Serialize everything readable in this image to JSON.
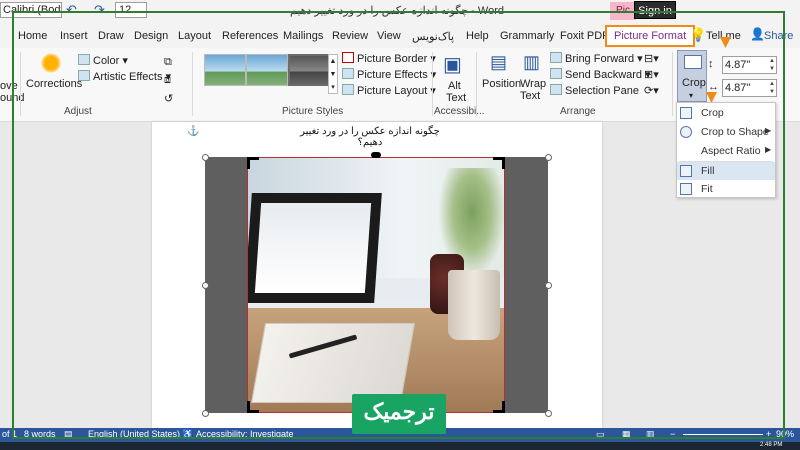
{
  "titlebar": {
    "font_name": "Calibri (Body",
    "font_size": "12",
    "document_title": "چگونه اندازه عکس را در ورد تغییر دهیم - Word",
    "context_tab": "Pic",
    "signin_label": "Sign in"
  },
  "tabs": [
    {
      "label": "Home"
    },
    {
      "label": "Insert"
    },
    {
      "label": "Draw"
    },
    {
      "label": "Design"
    },
    {
      "label": "Layout"
    },
    {
      "label": "References"
    },
    {
      "label": "Mailings"
    },
    {
      "label": "Review"
    },
    {
      "label": "View"
    },
    {
      "label": "پاک‌نویس"
    },
    {
      "label": "Help"
    },
    {
      "label": "Grammarly"
    },
    {
      "label": "Foxit PDF"
    },
    {
      "label": "Picture Format"
    }
  ],
  "tellme_label": "Tell me",
  "share_label": "Share",
  "ribbon": {
    "left_partial_1": "ove",
    "left_partial_2": "ound",
    "corrections": "Corrections",
    "color": "Color",
    "artistic_effects": "Artistic Effects",
    "adjust_label": "Adjust",
    "picture_border": "Picture Border",
    "picture_effects": "Picture Effects",
    "picture_layout": "Picture Layout",
    "picture_styles_label": "Picture Styles",
    "alt_text_1": "Alt",
    "alt_text_2": "Text",
    "accessibility_label": "Accessibi...",
    "position": "Position",
    "wrap_text_1": "Wrap",
    "wrap_text_2": "Text",
    "bring_forward": "Bring Forward",
    "send_backward": "Send Backward",
    "selection_pane": "Selection Pane",
    "arrange_label": "Arrange",
    "crop": "Crop",
    "height_value": "4.87\"",
    "width_value": "4.87\""
  },
  "crop_menu": {
    "items": [
      {
        "label": "Crop",
        "arrow": ""
      },
      {
        "label": "Crop to Shape",
        "arrow": "▶"
      },
      {
        "label": "Aspect Ratio",
        "arrow": "▶"
      },
      {
        "label": "Fill",
        "arrow": ""
      },
      {
        "label": "Fit",
        "arrow": ""
      }
    ]
  },
  "document": {
    "heading": "چگونه اندازه عکس را در ورد تغییر دهیم؟"
  },
  "statusbar": {
    "page": "of 1",
    "words": "8 words",
    "language": "English (United States)",
    "accessibility": "Accessibility: Investigate",
    "zoom": "90%"
  },
  "taskbar": {
    "time": "2:48 PM"
  },
  "watermark": {
    "text": "ترجمیک"
  },
  "colors": {
    "accent_orange": "#f08b16",
    "word_blue": "#2b579a",
    "picture_format_purple": "#7d2b8b",
    "frame_green": "#2f7d2f",
    "watermark_green": "#1aa464"
  }
}
